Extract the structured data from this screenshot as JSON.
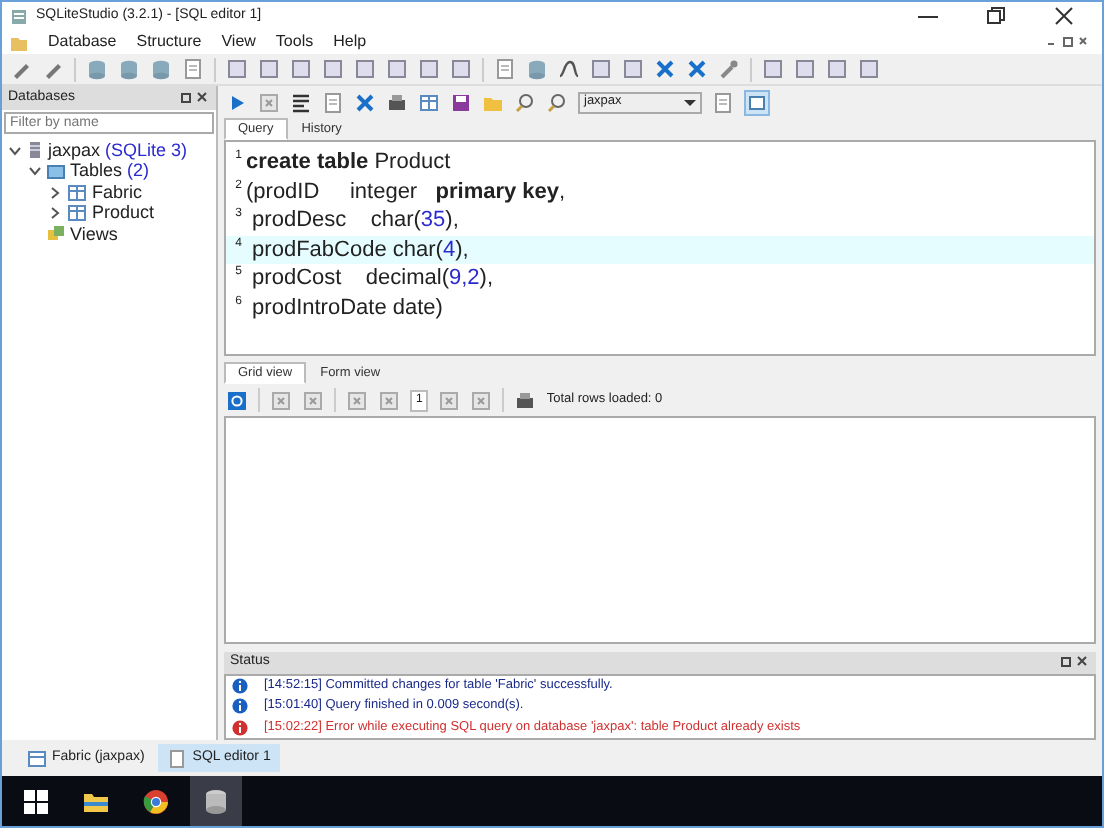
{
  "window": {
    "title": "SQLiteStudio (3.2.1) - [SQL editor 1]"
  },
  "menu": [
    "Database",
    "Structure",
    "View",
    "Tools",
    "Help"
  ],
  "databases_panel": {
    "title": "Databases",
    "filter": {
      "placeholder": "Filter by name"
    },
    "tree": [
      {
        "label": "jaxpax",
        "detail": "(SQLite 3)",
        "expanded": true,
        "children": [
          {
            "label": "Tables",
            "detail": "(2)",
            "expanded": true,
            "children": [
              {
                "label": "Fabric",
                "expanded": false
              },
              {
                "label": "Product",
                "expanded": false
              }
            ]
          },
          {
            "label": "Views"
          }
        ]
      }
    ]
  },
  "editor": {
    "database": "jaxpax",
    "tabs": [
      {
        "label": "Query",
        "selected": true
      },
      {
        "label": "History",
        "selected": false
      }
    ],
    "lines": [
      {
        "number": "1",
        "highlighted": false,
        "tokens": [
          {
            "kind": "keyword",
            "text": "create table"
          },
          {
            "kind": "plain",
            "text": " Product"
          }
        ]
      },
      {
        "number": "2",
        "highlighted": false,
        "tokens": [
          {
            "kind": "plain",
            "text": "(prodID     integer   "
          },
          {
            "kind": "keyword",
            "text": "primary key"
          },
          {
            "kind": "plain",
            "text": ","
          }
        ]
      },
      {
        "number": "3",
        "highlighted": false,
        "tokens": [
          {
            "kind": "plain",
            "text": " prodDesc    char("
          },
          {
            "kind": "number",
            "text": "35"
          },
          {
            "kind": "plain",
            "text": "),"
          }
        ]
      },
      {
        "number": "4",
        "highlighted": true,
        "tokens": [
          {
            "kind": "plain",
            "text": " prodFabCode char("
          },
          {
            "kind": "number",
            "text": "4"
          },
          {
            "kind": "plain",
            "text": "),"
          }
        ]
      },
      {
        "number": "5",
        "highlighted": false,
        "tokens": [
          {
            "kind": "plain",
            "text": " prodCost    decimal("
          },
          {
            "kind": "number",
            "text": "9,2"
          },
          {
            "kind": "plain",
            "text": "),"
          }
        ]
      },
      {
        "number": "6",
        "highlighted": false,
        "tokens": [
          {
            "kind": "plain",
            "text": " prodIntroDate date)"
          }
        ]
      }
    ]
  },
  "results": {
    "tabs": [
      {
        "label": "Grid view",
        "selected": true
      },
      {
        "label": "Form view",
        "selected": false
      }
    ],
    "page": "1",
    "rows_loaded": "Total rows loaded: 0"
  },
  "status": {
    "title": "Status",
    "messages": [
      {
        "kind": "info",
        "time": "[14:52:15]",
        "text": "Committed changes for table 'Fabric' successfully."
      },
      {
        "kind": "info",
        "time": "[15:01:40]",
        "text": "Query finished in 0.009 second(s)."
      },
      {
        "kind": "error",
        "time": "[15:02:22]",
        "text": "Error while executing SQL query on database 'jaxpax': table Product already exists"
      }
    ]
  },
  "window_tabs": [
    {
      "label": "Fabric (jaxpax)",
      "selected": false
    },
    {
      "label": "SQL editor 1",
      "selected": true
    }
  ]
}
